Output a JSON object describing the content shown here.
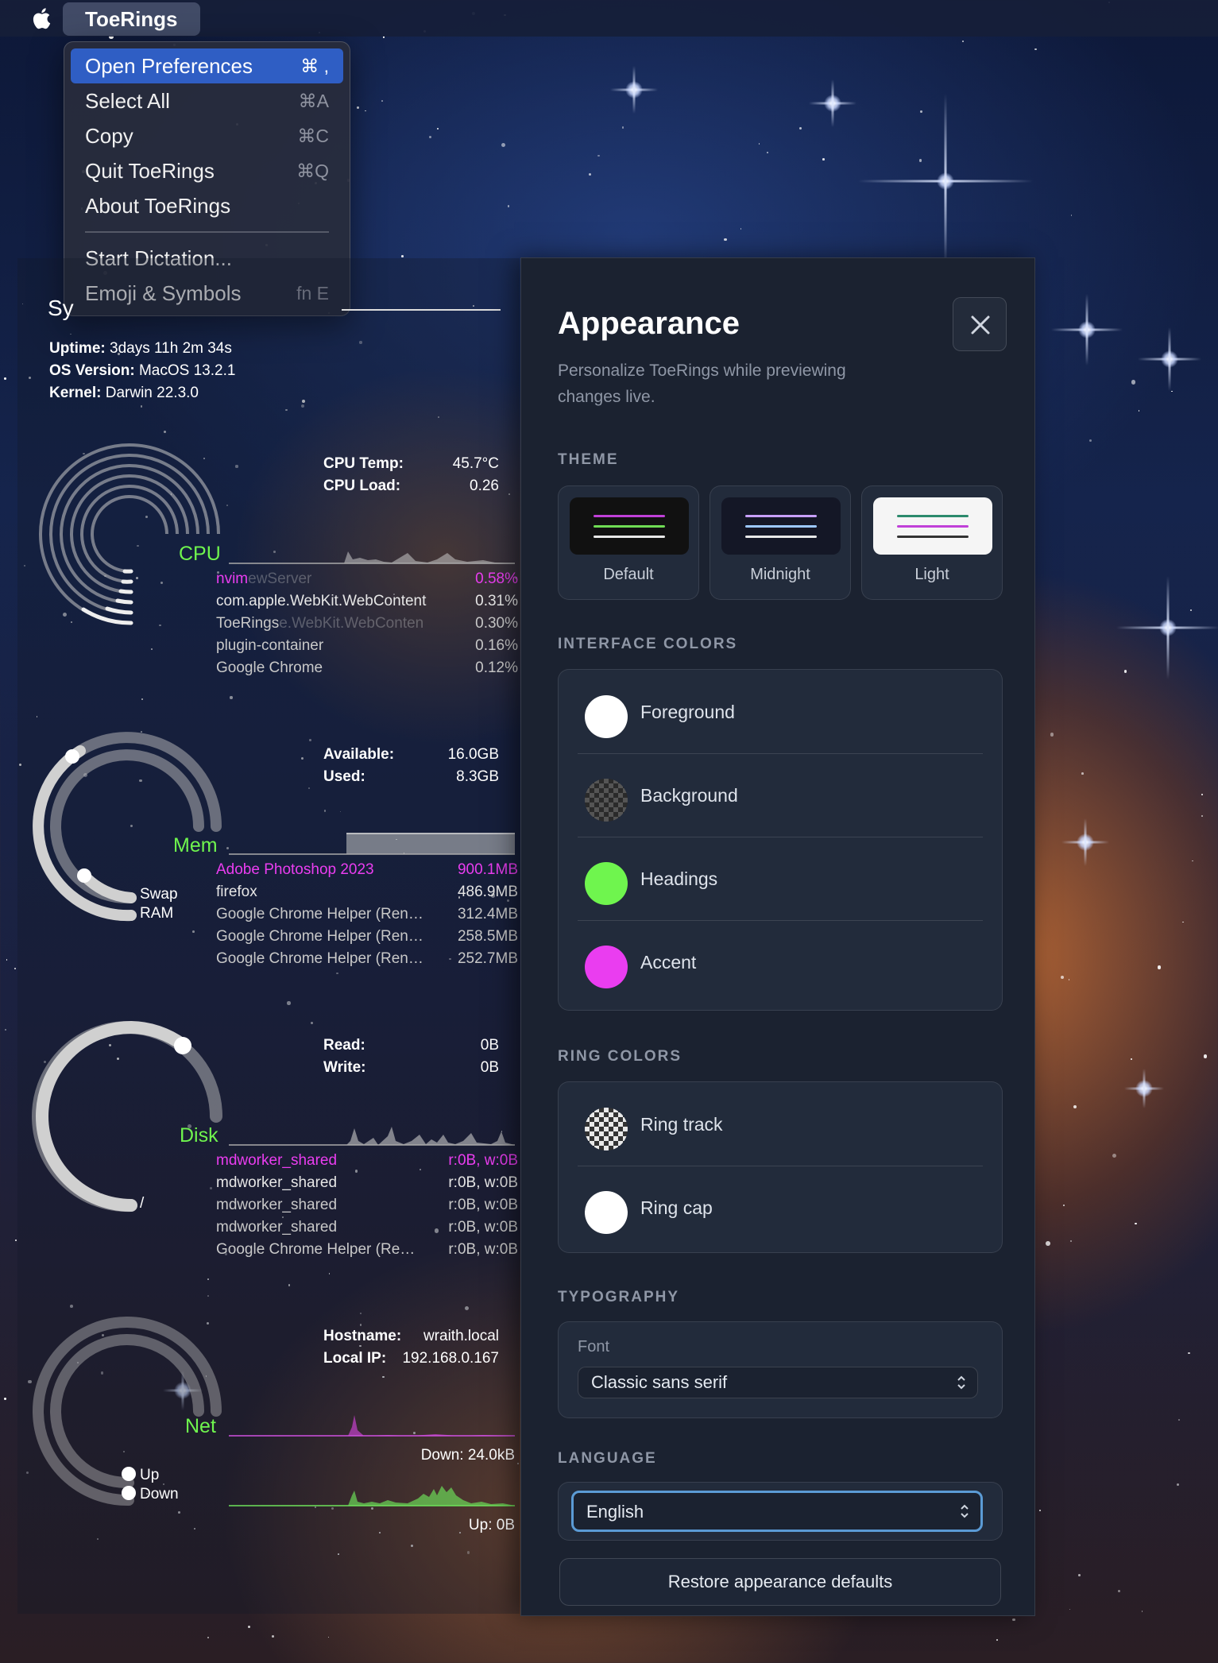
{
  "menubar": {
    "app_name": "ToeRings",
    "apple_icon": "apple-logo-icon"
  },
  "app_menu": {
    "items": [
      {
        "label": "Open Preferences",
        "shortcut": "⌘ ,",
        "active": true
      },
      {
        "label": "Select All",
        "shortcut": "⌘A"
      },
      {
        "label": "Copy",
        "shortcut": "⌘C"
      },
      {
        "label": "Quit ToeRings",
        "shortcut": "⌘Q"
      },
      {
        "label": "About ToeRings",
        "shortcut": ""
      }
    ],
    "items2": [
      {
        "label": "Start Dictation...",
        "shortcut": ""
      },
      {
        "label": "Emoji & Symbols",
        "shortcut": "fn E"
      }
    ]
  },
  "system": {
    "title": "Sy",
    "uptime_label": "Uptime:",
    "uptime": "3days 11h 2m 34s",
    "os_label": "OS Version:",
    "os": "MacOS 13.2.1",
    "kernel_label": "Kernel:",
    "kernel": "Darwin 22.3.0"
  },
  "cpu": {
    "label": "CPU",
    "temp_label": "CPU Temp:",
    "temp": "45.7°C",
    "load_label": "CPU Load:",
    "load": "0.26",
    "processes": [
      {
        "name": "nvim",
        "name_faded": "ewServer",
        "value": "0.58%"
      },
      {
        "name": "com.apple.WebKit.WebContent",
        "name_faded": "",
        "value": "0.31%"
      },
      {
        "name": "ToeRings",
        "name_faded": "e.WebKit.WebConten",
        "value": "0.30%"
      },
      {
        "name": "plugin-container",
        "name_faded": "",
        "value": "0.16%"
      },
      {
        "name": "Google Chrome",
        "name_faded": "",
        "value": "0.12%"
      }
    ]
  },
  "mem": {
    "label": "Mem",
    "available_label": "Available:",
    "available": "16.0GB",
    "used_label": "Used:",
    "used": "8.3GB",
    "swap_label": "Swap",
    "ram_label": "RAM",
    "processes": [
      {
        "name": "Adobe Photoshop 2023",
        "value": "900.1MB"
      },
      {
        "name": "firefox",
        "value": "486.9MB"
      },
      {
        "name": "Google Chrome Helper (Ren…",
        "value": "312.4MB"
      },
      {
        "name": "Google Chrome Helper (Ren…",
        "value": "258.5MB"
      },
      {
        "name": "Google Chrome Helper (Ren…",
        "value": "252.7MB"
      }
    ]
  },
  "disk": {
    "label": "Disk",
    "read_label": "Read:",
    "read": "0B",
    "write_label": "Write:",
    "write": "0B",
    "mount_label": "/",
    "processes": [
      {
        "name": "mdworker_shared",
        "value": "r:0B, w:0B"
      },
      {
        "name": "mdworker_shared",
        "value": "r:0B, w:0B"
      },
      {
        "name": "mdworker_shared",
        "value": "r:0B, w:0B"
      },
      {
        "name": "mdworker_shared",
        "value": "r:0B, w:0B"
      },
      {
        "name": "Google Chrome Helper (Re…",
        "value": "r:0B, w:0B"
      }
    ]
  },
  "net": {
    "label": "Net",
    "hostname_label": "Hostname:",
    "hostname": "wraith.local",
    "ip_label": "Local IP:",
    "ip": "192.168.0.167",
    "up_label": "Up",
    "down_label": "Down",
    "down_rate": "Down: 24.0kB",
    "up_rate": "Up: 0B"
  },
  "appearance": {
    "title": "Appearance",
    "subtitle": "Personalize ToeRings while previewing changes live.",
    "close_icon": "close-x-icon",
    "theme_section": "THEME",
    "themes": [
      {
        "name": "Default",
        "bg": "#111111",
        "lines": [
          "#c040d8",
          "#6fdc54",
          "#e8e8e8"
        ]
      },
      {
        "name": "Midnight",
        "bg": "#141726",
        "lines": [
          "#c8a0ff",
          "#9cc8ff",
          "#e8e8e8"
        ]
      },
      {
        "name": "Light",
        "bg": "#f5f5f5",
        "lines": [
          "#2c8a6c",
          "#c040d8",
          "#333333"
        ]
      }
    ],
    "interface_section": "INTERFACE COLORS",
    "interface_colors": [
      {
        "name": "Foreground",
        "color": "#ffffff"
      },
      {
        "name": "Background",
        "color": "transparent"
      },
      {
        "name": "Headings",
        "color": "#6ff54e"
      },
      {
        "name": "Accent",
        "color": "#ea3df0"
      }
    ],
    "ring_section": "RING COLORS",
    "ring_colors": [
      {
        "name": "Ring track",
        "color": "transparent"
      },
      {
        "name": "Ring cap",
        "color": "#ffffff"
      }
    ],
    "typography_section": "TYPOGRAPHY",
    "font_label": "Font",
    "font_value": "Classic sans serif",
    "language_section": "LANGUAGE",
    "language_value": "English",
    "restore_label": "Restore appearance defaults"
  }
}
